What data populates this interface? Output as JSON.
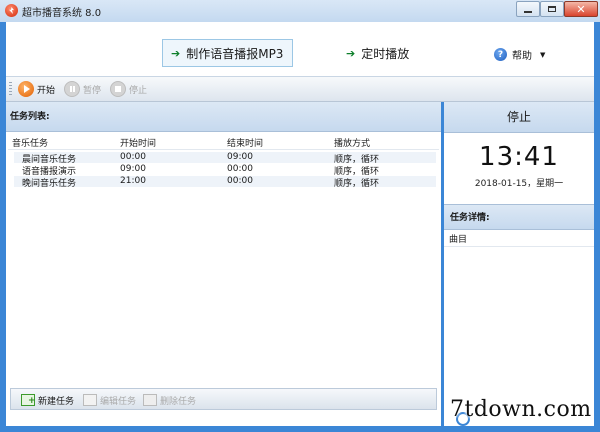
{
  "window": {
    "title": "超市播音系统 8.0"
  },
  "nav": {
    "mp3_label": "制作语音播报MP3",
    "timer_label": "定时播放",
    "help_label": "帮助"
  },
  "toolbar": {
    "start_label": "开始",
    "pause_label": "暂停",
    "stop_label": "停止"
  },
  "tasks": {
    "header": "任务列表:",
    "columns": [
      "音乐任务",
      "开始时间",
      "结束时间",
      "播放方式"
    ],
    "rows": [
      {
        "name": "晨间音乐任务",
        "start": "00:00",
        "end": "09:00",
        "mode": "顺序，循环"
      },
      {
        "name": "语音播报演示",
        "start": "09:00",
        "end": "00:00",
        "mode": "顺序，循环"
      },
      {
        "name": "晚间音乐任务",
        "start": "21:00",
        "end": "00:00",
        "mode": "顺序，循环"
      }
    ]
  },
  "bottom": {
    "new_label": "新建任务",
    "edit_label": "编辑任务",
    "delete_label": "删除任务"
  },
  "status": {
    "state": "停止",
    "time": "13:41",
    "date": "2018-01-15，星期一"
  },
  "detail": {
    "header": "任务详情:",
    "column": "曲目"
  },
  "watermark": "7tdown.com",
  "colors": {
    "accent": "#3b86d6",
    "start_orange": "#e25f00",
    "nav_arrow": "#0d7f2a"
  }
}
